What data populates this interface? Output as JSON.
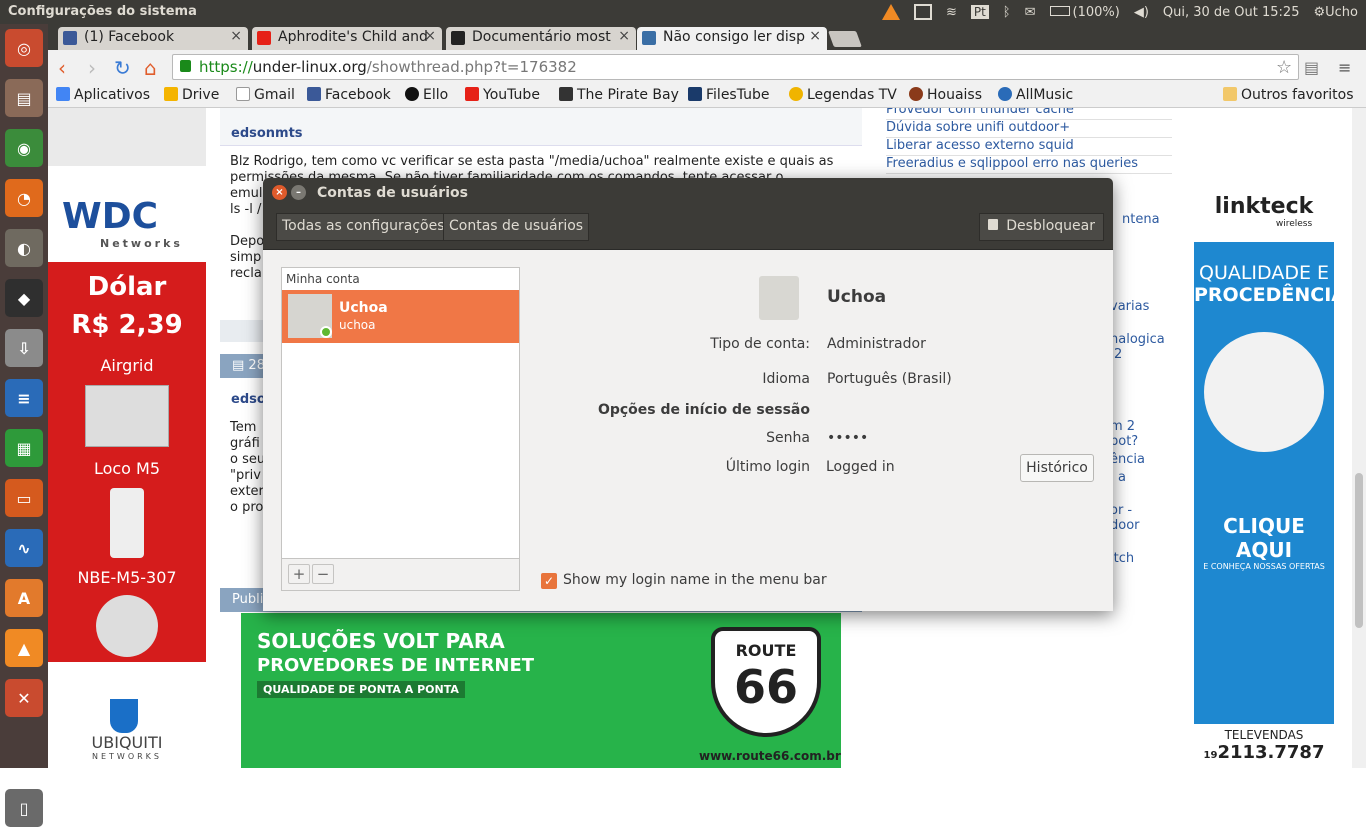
{
  "top_panel": {
    "app_name": "Configurações do sistema",
    "battery": "(100%)",
    "keyboard_layout": "Pt",
    "datetime": "Qui, 30 de Out 15:25",
    "user": "Ucho"
  },
  "browser": {
    "tabs": [
      {
        "label": "(1) Facebook",
        "icon_color": "#3b5998"
      },
      {
        "label": "Aphrodite's Child and",
        "icon_color": "#e62117"
      },
      {
        "label": "Documentário most",
        "icon_color": "#222222"
      },
      {
        "label": "Não consigo ler disp",
        "icon_color": "#3a6ea5"
      }
    ],
    "url_scheme": "https://",
    "url_host": "under-linux.org",
    "url_path": "/showthread.php?t=176382",
    "bookmarks": [
      "Aplicativos",
      "Drive",
      "Gmail",
      "Facebook",
      "Ello",
      "YouTube",
      "The Pirate Bay",
      "FilesTube",
      "Legendas TV",
      "Houaiss",
      "AllMusic"
    ],
    "other_bookmarks": "Outros favoritos"
  },
  "page": {
    "post_author": "edsonmts",
    "post_text_1": "Blz Rodrigo, tem como vc verificar se esta pasta \"/media/uchoa\" realmente existe e quais as",
    "post_text_2": "permissões da mesma. Se não tiver familiaridade com os comandos, tente acessar o",
    "post_text_3": "emul",
    "post_text_4": "ls -l /",
    "post_text_5": "Depo",
    "post_text_6": "simp",
    "post_text_7": "recla",
    "post_num": "28",
    "post_author_2": "edso",
    "post2_lines": [
      "Tem",
      "gráfi",
      "o seu",
      "\"priv",
      "exter",
      "o pro"
    ],
    "publi": "Publi",
    "sidebar_links": [
      "Provedor com thunder cache",
      "Dúvida sobre unifi outdoor+",
      "Liberar acesso externo squid",
      "Freeradius e sqlippool erro nas queries"
    ],
    "sidebar_fragments": [
      "ntena",
      "varias",
      "nalogica",
      "2",
      "m 2",
      "pot?",
      "ência",
      "a",
      "or -",
      "door",
      "itch"
    ],
    "left_ad": {
      "logo": "WDC",
      "logo_sub": "Networks",
      "dolar_label": "Dólar",
      "dolar_value": "R$ 2,39",
      "products": [
        "Airgrid",
        "Loco M5",
        "NBE-M5-307"
      ],
      "brand": "UBIQUITI",
      "brand_sub": "NETWORKS"
    },
    "right_ad": {
      "brand": "linkteck",
      "brand_sub": "wireless",
      "headline_1": "QUALIDADE E",
      "headline_2": "PROCEDÊNCIA",
      "cta": "CLIQUE AQUI",
      "cta_sub": "E CONHEÇA NOSSAS OFERTAS",
      "phone_label": "TELEVENDAS",
      "phone_area": "19",
      "phone_number": "2113.7787"
    },
    "banner": {
      "line1": "SOLUÇÕES VOLT PARA",
      "line2": "PROVEDORES DE INTERNET",
      "line3": "QUALIDADE DE PONTA A PONTA",
      "route": "ROUTE",
      "route_num": "66",
      "url": "www.route66.com.br"
    }
  },
  "dialog": {
    "title": "Contas de usuários",
    "breadcrumb_all": "Todas as configurações",
    "breadcrumb_current": "Contas de usuários",
    "unlock_label": "Desbloquear",
    "list_header": "Minha conta",
    "user_display": "Uchoa",
    "user_login": "uchoa",
    "add_symbol": "+",
    "remove_symbol": "−",
    "name": "Uchoa",
    "fields": {
      "account_type_label": "Tipo de conta:",
      "account_type": "Administrador",
      "language_label": "Idioma",
      "language": "Português (Brasil)",
      "login_options_label": "Opções de início de sessão",
      "password_label": "Senha",
      "password": "•••••",
      "last_login_label": "Último login",
      "last_login": "Logged in",
      "history_button": "Histórico"
    },
    "show_login_checkbox": "Show my login name in the menu bar",
    "show_login_checked": true,
    "accent_color": "#f07746"
  }
}
